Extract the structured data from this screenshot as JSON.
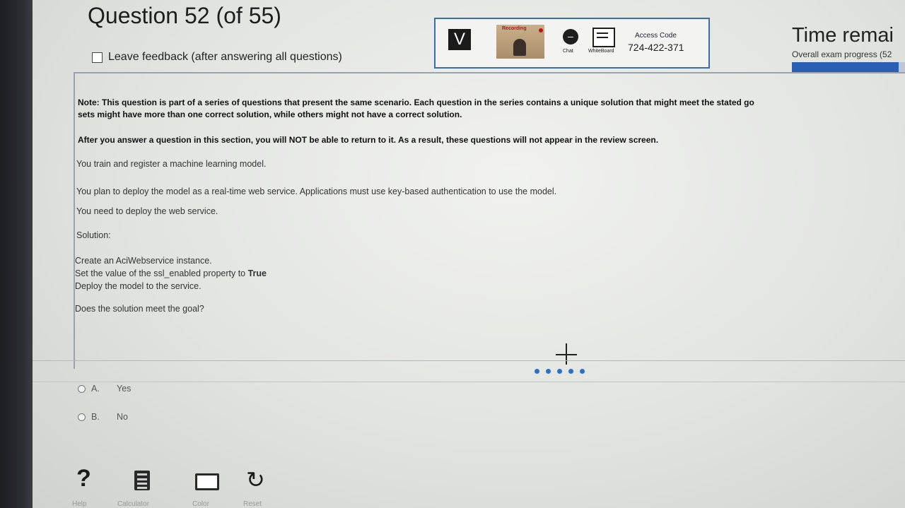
{
  "header": {
    "question_title": "Question 52 (of 55)",
    "feedback_label": "Leave feedback (after answering all questions)"
  },
  "toolbar": {
    "recording_label": "Recording",
    "chat_label": "Chat",
    "whiteboard_label": "WhiteBoard",
    "access_code_label": "Access Code",
    "access_code": "724-422-371"
  },
  "timer": {
    "title": "Time remai",
    "progress_label": "Overall exam progress (52",
    "progress_fraction": 0.945
  },
  "question": {
    "note_line1": "Note: This question is part of a series of questions that present the same scenario. Each question in the series contains a unique solution that might meet the stated go",
    "note_line2": "sets might have more than one correct solution, while others might not have a correct solution.",
    "note_line3": "After you answer a question in this section, you will NOT be able to return to it. As a result, these questions will not appear in the review screen.",
    "line_train": "You train and register a machine learning model.",
    "line_plan": "You plan to deploy the model as a real-time web service. Applications must use key-based authentication to use the model.",
    "line_need": "You need to deploy the web service.",
    "solution_label": "Solution:",
    "solution_step1": "Create an AciWebservice instance.",
    "solution_step2_prefix": "Set the value of the ssl_enabled property to ",
    "solution_step2_value": "True",
    "solution_step3": "Deploy the model to the service.",
    "prompt": "Does the solution meet the goal?"
  },
  "options": [
    {
      "letter": "A.",
      "text": "Yes"
    },
    {
      "letter": "B.",
      "text": "No"
    }
  ],
  "tools": {
    "help_label": "Help",
    "calculator_label": "Calculator",
    "color_label": "Color",
    "reset_label": "Reset"
  }
}
